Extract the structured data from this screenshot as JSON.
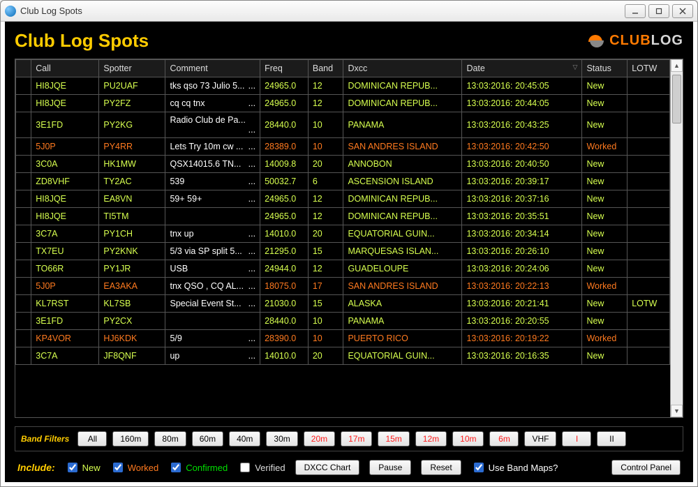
{
  "window": {
    "title": "Club Log Spots"
  },
  "heading": "Club Log Spots",
  "logo": {
    "part1": "CLUB",
    "part2": "LOG"
  },
  "columns": {
    "call": "Call",
    "spotter": "Spotter",
    "comment": "Comment",
    "freq": "Freq",
    "band": "Band",
    "dxcc": "Dxcc",
    "date": "Date",
    "status": "Status",
    "lotw": "LOTW"
  },
  "rows": [
    {
      "call": "HI8JQE",
      "spotter": "PU2UAF",
      "comment": "tks qso 73 Julio 5...",
      "freq": "24965.0",
      "band": "12",
      "dxcc": "DOMINICAN REPUB...",
      "date": "13:03:2016: 20:45:05",
      "status": "New",
      "lotw": "",
      "color": "yellow"
    },
    {
      "call": "HI8JQE",
      "spotter": "PY2FZ",
      "comment": "cq cq tnx",
      "freq": "24965.0",
      "band": "12",
      "dxcc": "DOMINICAN REPUB...",
      "date": "13:03:2016: 20:44:05",
      "status": "New",
      "lotw": "",
      "color": "yellow"
    },
    {
      "call": "3E1FD",
      "spotter": "PY2KG",
      "comment": "Radio Club de Pa...",
      "freq": "28440.0",
      "band": "10",
      "dxcc": "PANAMA",
      "date": "13:03:2016: 20:43:25",
      "status": "New",
      "lotw": "",
      "color": "yellow"
    },
    {
      "call": "5J0P",
      "spotter": "PY4RR",
      "comment": "Lets Try 10m cw ...",
      "freq": "28389.0",
      "band": "10",
      "dxcc": "SAN ANDRES ISLAND",
      "date": "13:03:2016: 20:42:50",
      "status": "Worked",
      "lotw": "",
      "color": "orange"
    },
    {
      "call": "3C0A",
      "spotter": "HK1MW",
      "comment": "QSX14015.6 TN...",
      "freq": "14009.8",
      "band": "20",
      "dxcc": "ANNOBON",
      "date": "13:03:2016: 20:40:50",
      "status": "New",
      "lotw": "",
      "color": "yellow"
    },
    {
      "call": "ZD8VHF",
      "spotter": "TY2AC",
      "comment": "539",
      "freq": "50032.7",
      "band": "6",
      "dxcc": "ASCENSION ISLAND",
      "date": "13:03:2016: 20:39:17",
      "status": "New",
      "lotw": "",
      "color": "yellow"
    },
    {
      "call": "HI8JQE",
      "spotter": "EA8VN",
      "comment": "59+ 59+",
      "freq": "24965.0",
      "band": "12",
      "dxcc": "DOMINICAN REPUB...",
      "date": "13:03:2016: 20:37:16",
      "status": "New",
      "lotw": "",
      "color": "yellow"
    },
    {
      "call": "HI8JQE",
      "spotter": "TI5TM",
      "comment": "",
      "freq": "24965.0",
      "band": "12",
      "dxcc": "DOMINICAN REPUB...",
      "date": "13:03:2016: 20:35:51",
      "status": "New",
      "lotw": "",
      "color": "yellow"
    },
    {
      "call": "3C7A",
      "spotter": "PY1CH",
      "comment": "tnx up",
      "freq": "14010.0",
      "band": "20",
      "dxcc": "EQUATORIAL GUIN...",
      "date": "13:03:2016: 20:34:14",
      "status": "New",
      "lotw": "",
      "color": "yellow"
    },
    {
      "call": "TX7EU",
      "spotter": "PY2KNK",
      "comment": "5/3 via SP split 5...",
      "freq": "21295.0",
      "band": "15",
      "dxcc": "MARQUESAS ISLAN...",
      "date": "13:03:2016: 20:26:10",
      "status": "New",
      "lotw": "",
      "color": "yellow"
    },
    {
      "call": "TO66R",
      "spotter": "PY1JR",
      "comment": "USB",
      "freq": "24944.0",
      "band": "12",
      "dxcc": "GUADELOUPE",
      "date": "13:03:2016: 20:24:06",
      "status": "New",
      "lotw": "",
      "color": "yellow"
    },
    {
      "call": "5J0P",
      "spotter": "EA3AKA",
      "comment": "tnx QSO , CQ AL...",
      "freq": "18075.0",
      "band": "17",
      "dxcc": "SAN ANDRES ISLAND",
      "date": "13:03:2016: 20:22:13",
      "status": "Worked",
      "lotw": "",
      "color": "orange"
    },
    {
      "call": "KL7RST",
      "spotter": "KL7SB",
      "comment": "Special Event St...",
      "freq": "21030.0",
      "band": "15",
      "dxcc": "ALASKA",
      "date": "13:03:2016: 20:21:41",
      "status": "New",
      "lotw": "LOTW",
      "color": "yellow"
    },
    {
      "call": "3E1FD",
      "spotter": "PY2CX",
      "comment": "",
      "freq": "28440.0",
      "band": "10",
      "dxcc": "PANAMA",
      "date": "13:03:2016: 20:20:55",
      "status": "New",
      "lotw": "",
      "color": "yellow"
    },
    {
      "call": "KP4VOR",
      "spotter": "HJ6KDK",
      "comment": "5/9",
      "freq": "28390.0",
      "band": "10",
      "dxcc": "PUERTO RICO",
      "date": "13:03:2016: 20:19:22",
      "status": "Worked",
      "lotw": "",
      "color": "orange"
    },
    {
      "call": "3C7A",
      "spotter": "JF8QNF",
      "comment": "up",
      "freq": "14010.0",
      "band": "20",
      "dxcc": "EQUATORIAL GUIN...",
      "date": "13:03:2016: 20:16:35",
      "status": "New",
      "lotw": "",
      "color": "yellow"
    }
  ],
  "band_filters": {
    "label": "Band Filters",
    "buttons": [
      {
        "label": "All",
        "red": false
      },
      {
        "label": "160m",
        "red": false
      },
      {
        "label": "80m",
        "red": false
      },
      {
        "label": "60m",
        "red": false
      },
      {
        "label": "40m",
        "red": false
      },
      {
        "label": "30m",
        "red": false
      },
      {
        "label": "20m",
        "red": true
      },
      {
        "label": "17m",
        "red": true
      },
      {
        "label": "15m",
        "red": true
      },
      {
        "label": "12m",
        "red": true
      },
      {
        "label": "10m",
        "red": true
      },
      {
        "label": "6m",
        "red": true
      },
      {
        "label": "VHF",
        "red": false
      },
      {
        "label": "I",
        "red": true
      },
      {
        "label": "II",
        "red": false
      }
    ]
  },
  "include": {
    "label": "Include:",
    "new": "New",
    "worked": "Worked",
    "confirmed": "Confirmed",
    "verified": "Verified",
    "dxcc_chart": "DXCC Chart",
    "pause": "Pause",
    "reset": "Reset",
    "use_maps": "Use Band Maps?",
    "control_panel": "Control Panel"
  }
}
